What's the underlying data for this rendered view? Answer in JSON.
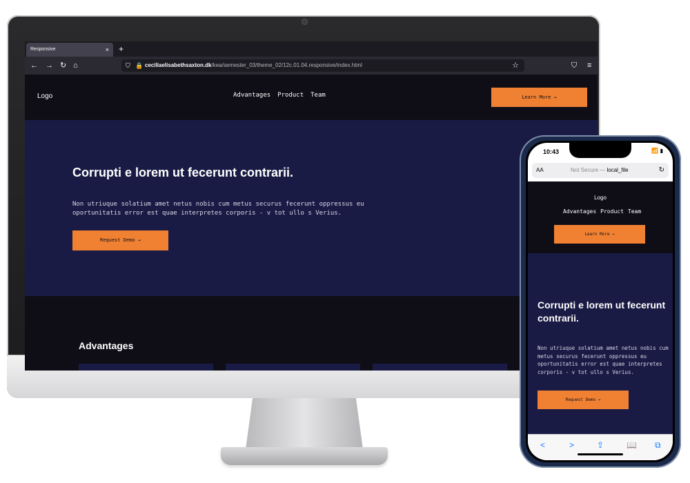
{
  "browser": {
    "tab_title": "Responsive",
    "tab_close": "×",
    "new_tab": "+",
    "back": "←",
    "forward": "→",
    "reload": "↻",
    "home": "⌂",
    "shield": "⛉",
    "lock": "🔒",
    "url_host": "ceciliaelisabethsaxton.dk",
    "url_path": "/kea/semester_03/theme_02/12c.01.04.responsive/index.html",
    "bookmark": "☆",
    "pocket": "⛉",
    "menu": "≡"
  },
  "site": {
    "logo": "Logo",
    "nav": [
      "Advantages",
      "Product",
      "Team"
    ],
    "learn_more": "Learn More →",
    "hero_title": "Corrupti e lorem ut fecerunt contrarii.",
    "hero_text": "Non utriuque solatium amet netus nobis cum metus securus fecerunt oppressus eu oportunitatis error est quae interpretes corporis - v tot ullo s Verius.",
    "request_demo": "Request Demo →",
    "advantages_title": "Advantages"
  },
  "phone": {
    "time": "10:43",
    "status_icons": "📶 ▮",
    "aa": "AA",
    "address_prefix": "Not Secure — ",
    "address_file": "local_file",
    "reload": "↻",
    "toolbar": {
      "back": "<",
      "forward": ">",
      "share": "⇪",
      "bookmarks": "📖",
      "tabs": "⧉"
    }
  },
  "colors": {
    "accent": "#f08133",
    "hero_bg": "#1a1b45",
    "header_bg": "#0f0e17"
  }
}
